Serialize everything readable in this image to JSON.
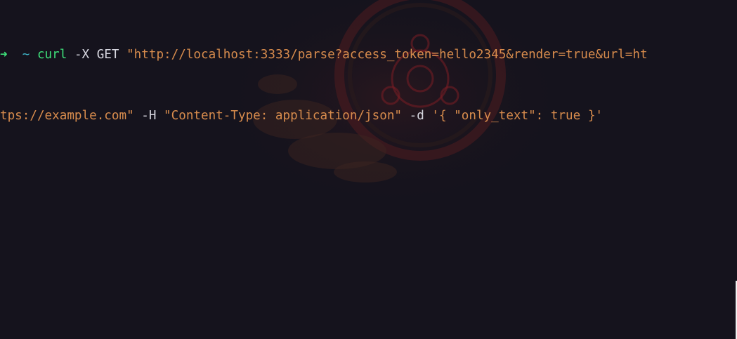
{
  "prompt": {
    "arrow": "➜",
    "cwd": "~"
  },
  "command": {
    "program": "curl",
    "method_flag": "-X",
    "method": "GET",
    "url_part1": "\"http://localhost:3333/parse?access_token=hello2345&render=true&url=ht",
    "url_part2": "tps://example.com\"",
    "header_flag": "-H",
    "header_value": "\"Content-Type: application/json\"",
    "data_flag": "-d",
    "data_value": "'{ \"only_text\": true }'"
  },
  "theme": {
    "background": "#15131d",
    "prompt_arrow": "#3ee07a",
    "cwd": "#3fb6c9",
    "command": "#3ee07a",
    "string": "#d88c4d",
    "foreground": "#d7d7e0",
    "wallpaper_accent": "#7a1e24"
  },
  "wallpaper": {
    "icon": "ubuntu-circle-of-friends-logo"
  }
}
